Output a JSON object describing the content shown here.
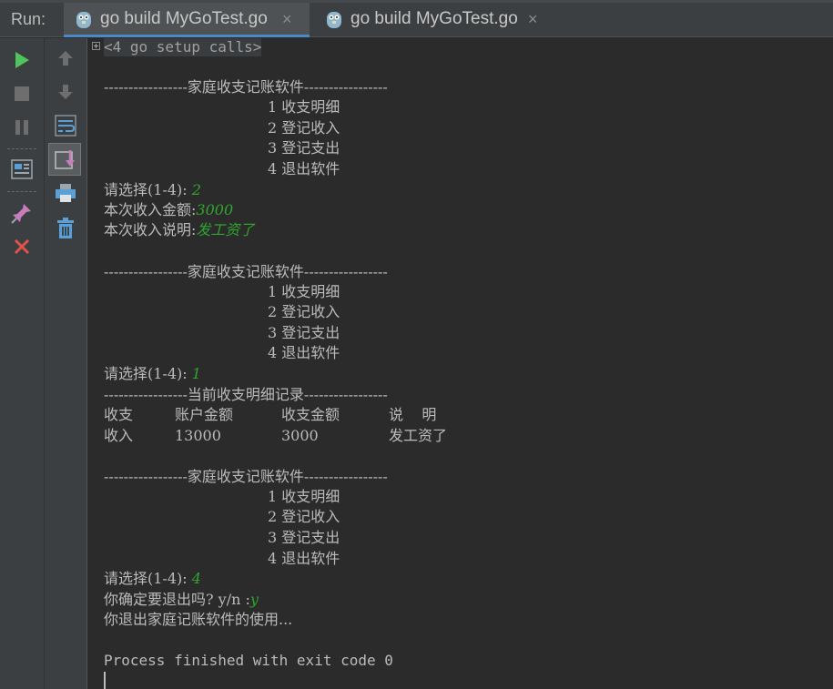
{
  "run_label": "Run:",
  "tabs": [
    {
      "label": "go build MyGoTest.go",
      "close": "×"
    },
    {
      "label": "go build MyGoTest.go",
      "close": "×"
    }
  ],
  "toolbar": {
    "icons": [
      "run-icon",
      "stop-icon",
      "pause-icon",
      "dump-threads-icon",
      "pin-tab-icon",
      "close-icon",
      "up-icon",
      "down-icon",
      "soft-wrap-icon",
      "scroll-to-end-icon",
      "print-icon",
      "clear-all-icon"
    ]
  },
  "console": {
    "setup": "<4 go setup calls>",
    "menu_header": "-----------------家庭收支记账软件-----------------",
    "menu_items": [
      "1 收支明细",
      "2 登记收入",
      "3 登记支出",
      "4 退出软件"
    ],
    "prompt": "请选择(1-4): ",
    "choice1": "2",
    "income_amount_label": "本次收入金额:",
    "income_amount_value": "3000",
    "income_desc_label": "本次收入说明:",
    "income_desc_value": "发工资了",
    "choice2": "1",
    "detail_header": "-----------------当前收支明细记录-----------------",
    "table_headers": [
      "收支",
      "账户金额",
      "收支金额",
      "说    明"
    ],
    "table_row": [
      "收入",
      "13000",
      "3000",
      "发工资了"
    ],
    "choice3": "4",
    "confirm_prompt": "你确定要退出吗? y/n :",
    "confirm_value": "y",
    "exit_msg": "你退出家庭记账软件的使用...",
    "process_finished": "Process finished with exit code 0"
  }
}
